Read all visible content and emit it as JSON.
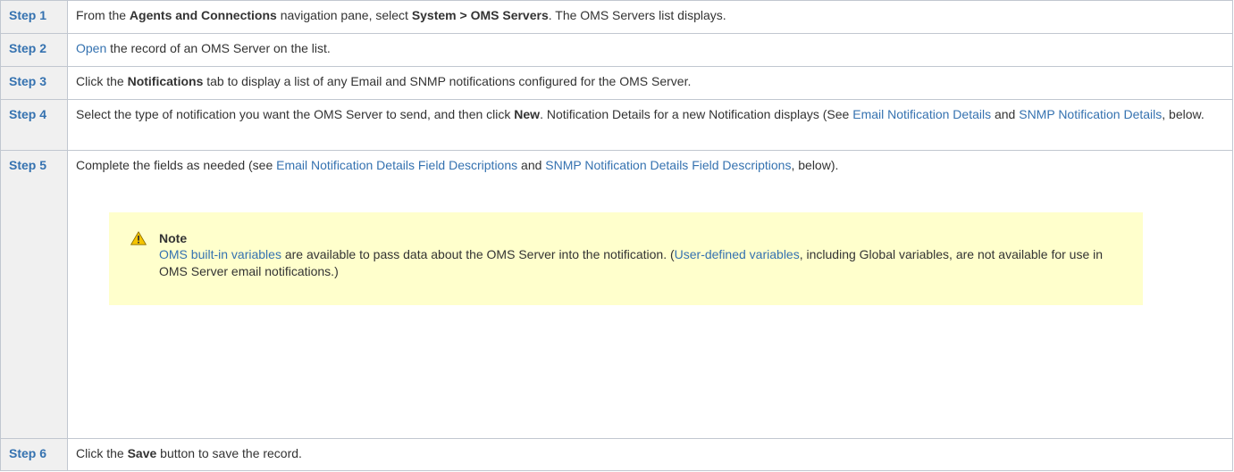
{
  "steps": [
    {
      "label": "Step 1",
      "pre": "From the ",
      "nav_pane": "Agents and Connections",
      "mid": " navigation pane, select ",
      "menu_path": "System > OMS Servers",
      "post": ". The OMS Servers list displays."
    },
    {
      "label": "Step 2",
      "link": "Open",
      "post": " the record of an OMS Server on the list."
    },
    {
      "label": "Step 3",
      "pre": "Click the ",
      "tab": "Notifications",
      "post": " tab to display a list of any Email and SNMP notifications configured for the OMS Server."
    },
    {
      "label": "Step 4",
      "pre": "Select the type of notification you want the OMS Server to send, and then click ",
      "button": "New",
      "mid": ". Notification Details for a new Notification displays (See ",
      "link1": "Email Notification Details",
      "and": " and ",
      "link2": "SNMP Notification Details",
      "post": ", below."
    },
    {
      "label": "Step 5",
      "pre": "Complete the fields as needed (see ",
      "link1": "Email Notification Details Field Descriptions",
      "and": " and ",
      "link2": "SNMP Notification Details Field Descriptions",
      "post": ", below).",
      "note": {
        "icon": "warning-icon",
        "title": "Note",
        "link1": "OMS built-in variables",
        "text1": " are available to pass data about the OMS Server into the notification. (",
        "link2": "User-defined variables",
        "text2": ", including Global variables, are not available for use in OMS Server email notifications.)"
      }
    },
    {
      "label": "Step 6",
      "pre": "Click the ",
      "button": "Save",
      "post": " button to save the record."
    }
  ],
  "colors": {
    "link": "#3572b0",
    "label_bg": "#f0f0f0",
    "border": "#c1c7d0",
    "note_bg": "#ffffcc",
    "warning": "#e6b800"
  }
}
